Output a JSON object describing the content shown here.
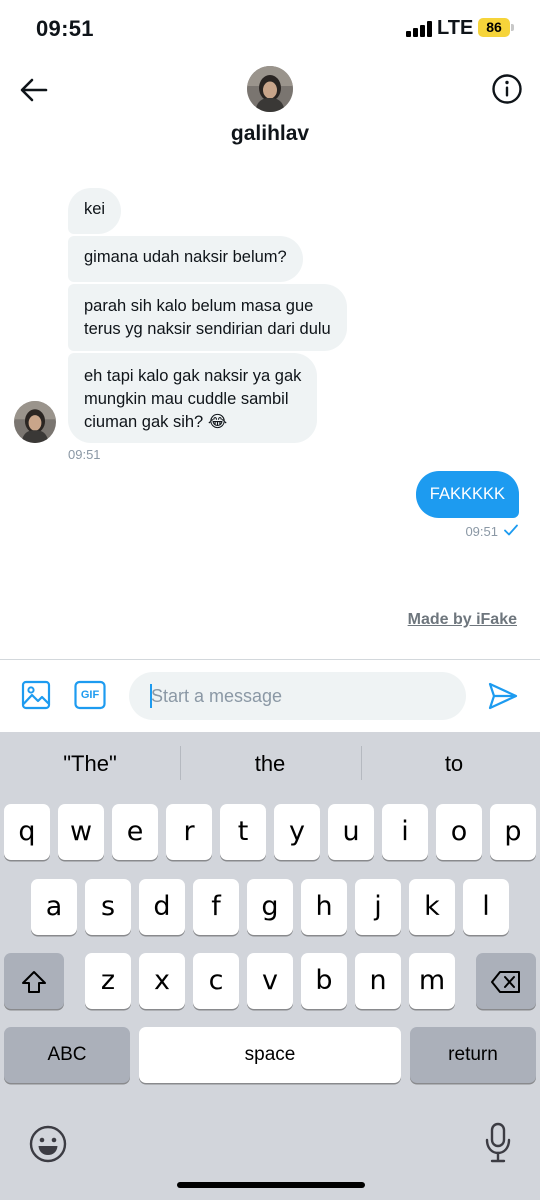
{
  "status_bar": {
    "time": "09:51",
    "network": "LTE",
    "battery": "86"
  },
  "header": {
    "name": "galihlav"
  },
  "messages_in": [
    {
      "line1": "kei",
      "line2": "",
      "line3": ""
    },
    {
      "line1": "gimana udah naksir belum?",
      "line2": "",
      "line3": ""
    },
    {
      "line1": "parah sih kalo belum masa gue",
      "line2": "terus yg naksir sendirian dari dulu",
      "line3": ""
    },
    {
      "line1": "eh tapi kalo gak naksir ya gak",
      "line2": "mungkin mau cuddle sambil",
      "line3": "ciuman gak sih? 😂"
    }
  ],
  "incoming_time": "09:51",
  "message_out": {
    "text": "FAKKKKK",
    "time": "09:51"
  },
  "watermark": "Made by iFake",
  "composer": {
    "placeholder": "Start a message",
    "gif_label": "GIF"
  },
  "keyboard": {
    "suggestions": [
      "\"The\"",
      "the",
      "to"
    ],
    "row1": [
      "q",
      "w",
      "e",
      "r",
      "t",
      "y",
      "u",
      "i",
      "o",
      "p"
    ],
    "row2": [
      "a",
      "s",
      "d",
      "f",
      "g",
      "h",
      "j",
      "k",
      "l"
    ],
    "row3": [
      "z",
      "x",
      "c",
      "v",
      "b",
      "n",
      "m"
    ],
    "abc_label": "ABC",
    "space_label": "space",
    "return_label": "return"
  }
}
